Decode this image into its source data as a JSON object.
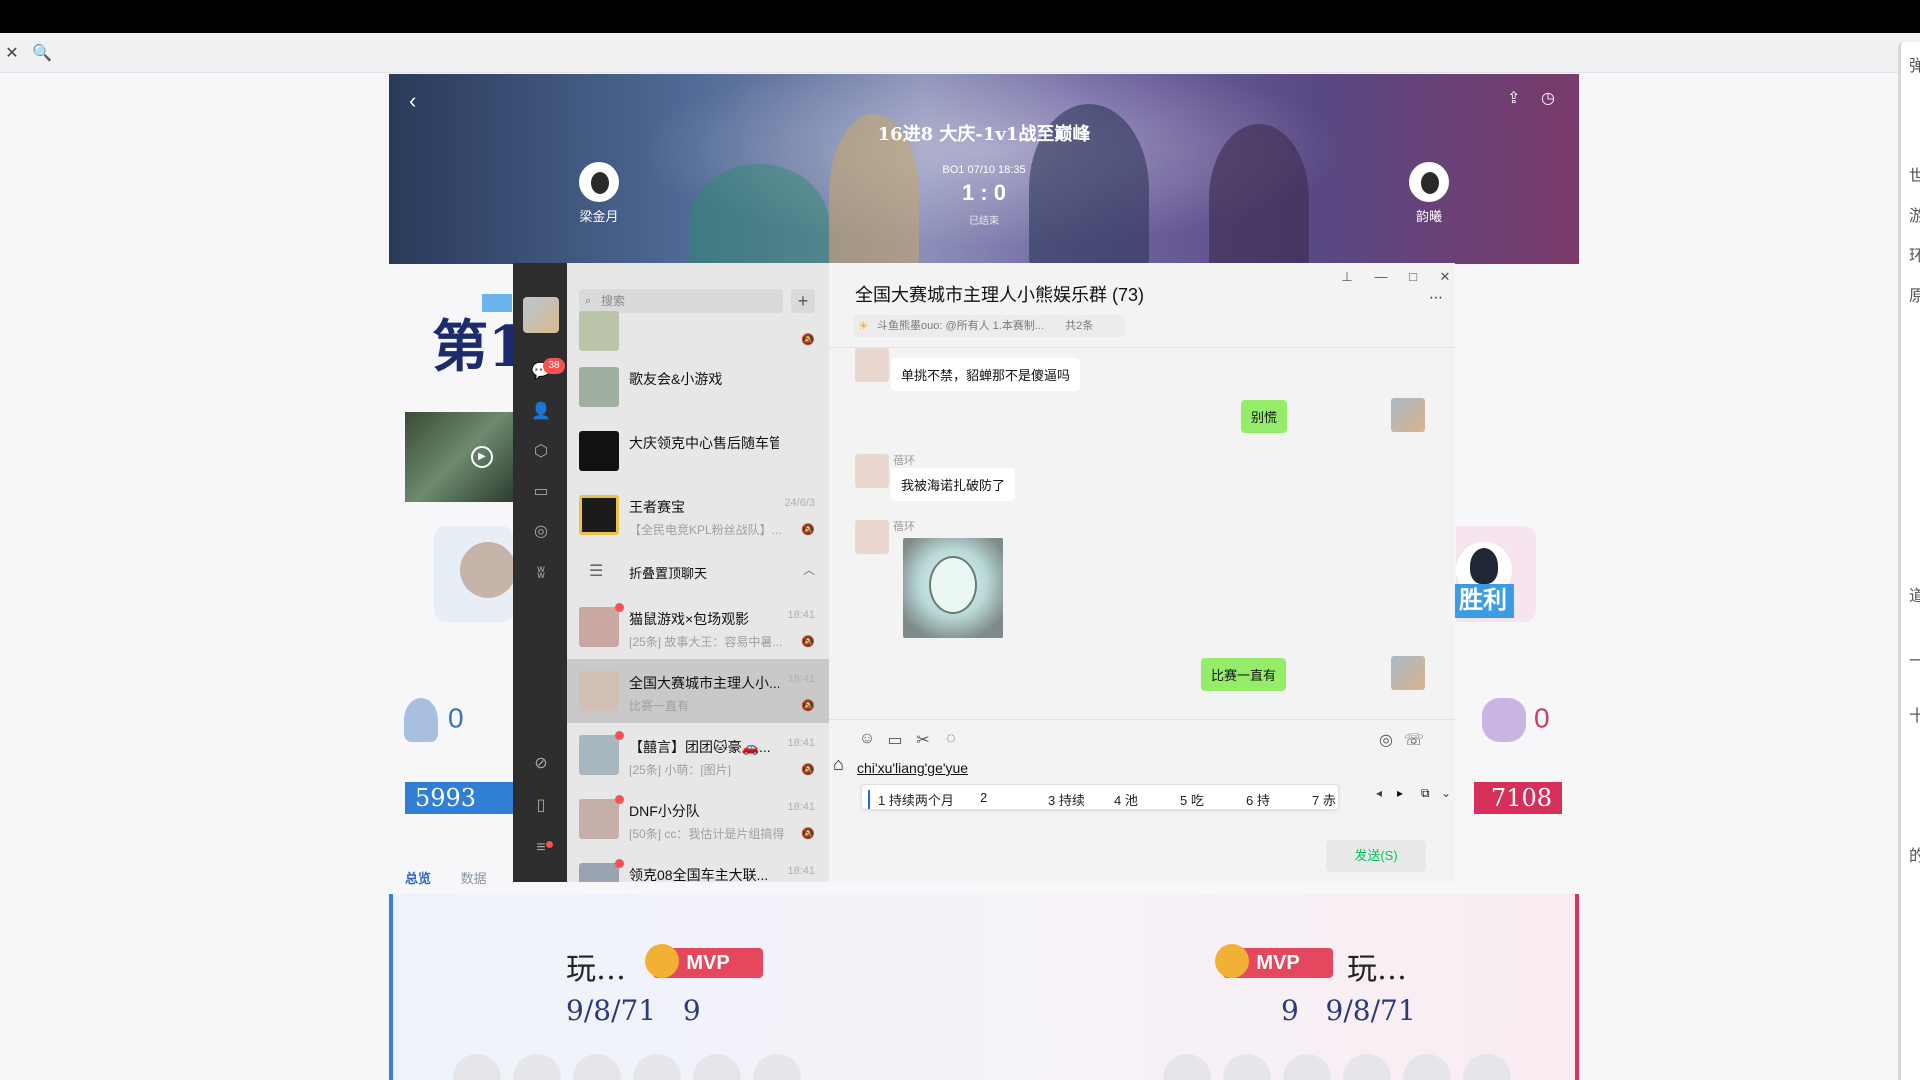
{
  "toolbar": {
    "close_glyph": "✕",
    "search_glyph": "🔍"
  },
  "right_panel": {
    "chars": [
      "弹",
      "世",
      "游",
      "环",
      "原",
      "道",
      "一",
      "十",
      "的"
    ]
  },
  "banner": {
    "title": "16进8 大庆-1v1战至巅峰",
    "meta": "BO1 07/10 18:35",
    "score": "1 : 0",
    "status": "已结束",
    "player_left": "梁金月",
    "player_right": "韵曦",
    "back_glyph": "‹",
    "share_glyph": "⇪",
    "refresh_glyph": "◷"
  },
  "background_page": {
    "title_fragment": "第1",
    "victory": "胜利",
    "stat_left": "0",
    "stat_right": "0",
    "score_left": "5993",
    "score_right": "7108",
    "tabs": [
      "总览",
      "数据"
    ],
    "mvp_label": "MVP",
    "left_player": {
      "name": "玩…",
      "kda": "9/8/71",
      "level": "9"
    },
    "right_player": {
      "name": "玩…",
      "kda": "9/8/71",
      "level": "9"
    }
  },
  "wechat": {
    "unread_badge": "38",
    "search_placeholder": "搜索",
    "add_glyph": "+",
    "chats": [
      {
        "name": "",
        "time": "",
        "preview": ""
      },
      {
        "name": "歌友会&小游戏",
        "time": "",
        "preview": ""
      },
      {
        "name": "大庆领克中心售后随车管家",
        "time": "",
        "preview": ""
      },
      {
        "name": "王者赛宝",
        "time": "24/6/3",
        "preview": "【全民电竞KPL粉丝战队】..."
      },
      {
        "name": "折叠置顶聊天",
        "time": "",
        "preview": ""
      },
      {
        "name": "猫鼠游戏×包场观影",
        "time": "18:41",
        "preview": "[25条] 故事大王：容易中暑..."
      },
      {
        "name": "全国大赛城市主理人小...",
        "time": "18:41",
        "preview": "比赛一直有"
      },
      {
        "name": "【囍言】团团🐱豪🚗...",
        "time": "18:41",
        "preview": "[25条] 小萌：[图片]"
      },
      {
        "name": "DNF小分队",
        "time": "18:41",
        "preview": "[50条] cc：我估计是片组搞得"
      },
      {
        "name": "领克08全国车主大联...",
        "time": "18:41",
        "preview": ""
      }
    ],
    "conversation": {
      "title": "全国大赛城市主理人小熊娱乐群 (73)",
      "notice": "斗鱼熊墨ouo: @所有人 1.本赛制...",
      "notice_count": "共2条",
      "messages": [
        {
          "sender": "",
          "text": "单挑不禁，貂蝉那不是傻逼吗",
          "mine": false
        },
        {
          "sender": "",
          "text": "别慌",
          "mine": true
        },
        {
          "sender": "蓓环",
          "text": "我被海诺扎破防了",
          "mine": false
        },
        {
          "sender": "蓓环",
          "text": "",
          "mine": false,
          "sticker": true
        },
        {
          "sender": "",
          "text": "比赛一直有",
          "mine": true
        }
      ],
      "input_text": "chi'xu'liang'ge'yue",
      "ime_candidates": [
        "1 持续两个月",
        "2",
        "3 持续",
        "4 池",
        "5 吃",
        "6 持",
        "7 赤"
      ],
      "send_label": "发送(S)"
    }
  },
  "colors": {
    "wechat_green": "#95ec69",
    "blue_team": "#2f7fd6",
    "red_team": "#d62f5a"
  },
  "icons": [
    "close-icon",
    "search-icon",
    "back-icon",
    "share-icon",
    "refresh-icon",
    "chat-icon",
    "contacts-icon",
    "box-icon",
    "folder-icon",
    "moments-icon",
    "miniapp-icon",
    "link-icon",
    "phone-icon",
    "menu-icon",
    "emoji-icon",
    "file-icon",
    "screenshot-icon",
    "chat-history-icon",
    "voice-icon",
    "call-icon",
    "pin-icon",
    "minimize-icon",
    "maximize-icon",
    "close-window-icon"
  ]
}
